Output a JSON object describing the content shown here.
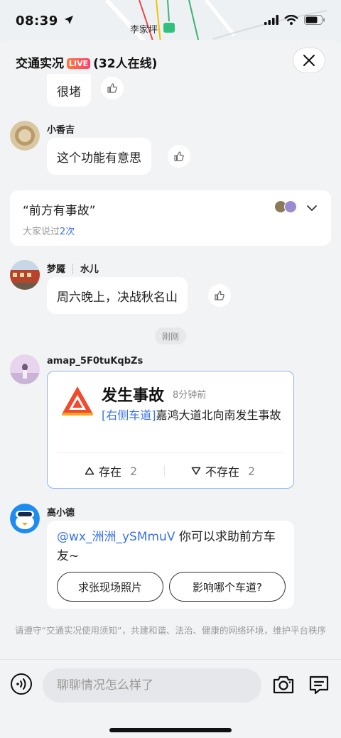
{
  "status": {
    "time": "08:39",
    "map_label": "李家坪"
  },
  "header": {
    "title": "交通实况",
    "live_badge": "LIVE",
    "online_count": "(32人在线)"
  },
  "messages": [
    {
      "type": "text",
      "text": "很堵"
    },
    {
      "type": "text",
      "username": "小香吉",
      "text": "这个功能有意思"
    },
    {
      "type": "text",
      "username": "梦魇",
      "username_suffix": "水儿",
      "text": "周六晚上，决战秋名山"
    }
  ],
  "summary": {
    "quote": "“前方有事故”",
    "sub_prefix": "大家说过",
    "sub_count": "2次"
  },
  "time_divider": "刚刚",
  "event": {
    "username": "amap_5F0tuKqbZs",
    "title": "发生事故",
    "ago": "8分钟前",
    "tag": "[右侧车道]",
    "description": "嘉鸿大道北向南发生事故",
    "exists_label": "存在",
    "exists_count": "2",
    "not_exists_label": "不存在",
    "not_exists_count": "2"
  },
  "reply": {
    "username": "高小德",
    "mention": "@wx_洲洲_ySMmuV",
    "text": " 你可以求助前方车友~",
    "chips": [
      "求张现场照片",
      "影响哪个车道?"
    ]
  },
  "notice": "请遵守“交通实况使用须知”，共建和谐、法治、健康的网络环境，维护平台秩序",
  "input": {
    "placeholder": "聊聊情况怎么样了"
  },
  "colors": {
    "accent_blue": "#3a72e8",
    "live_badge": "#ff5a4e",
    "card_border": "#8fb2ef"
  }
}
